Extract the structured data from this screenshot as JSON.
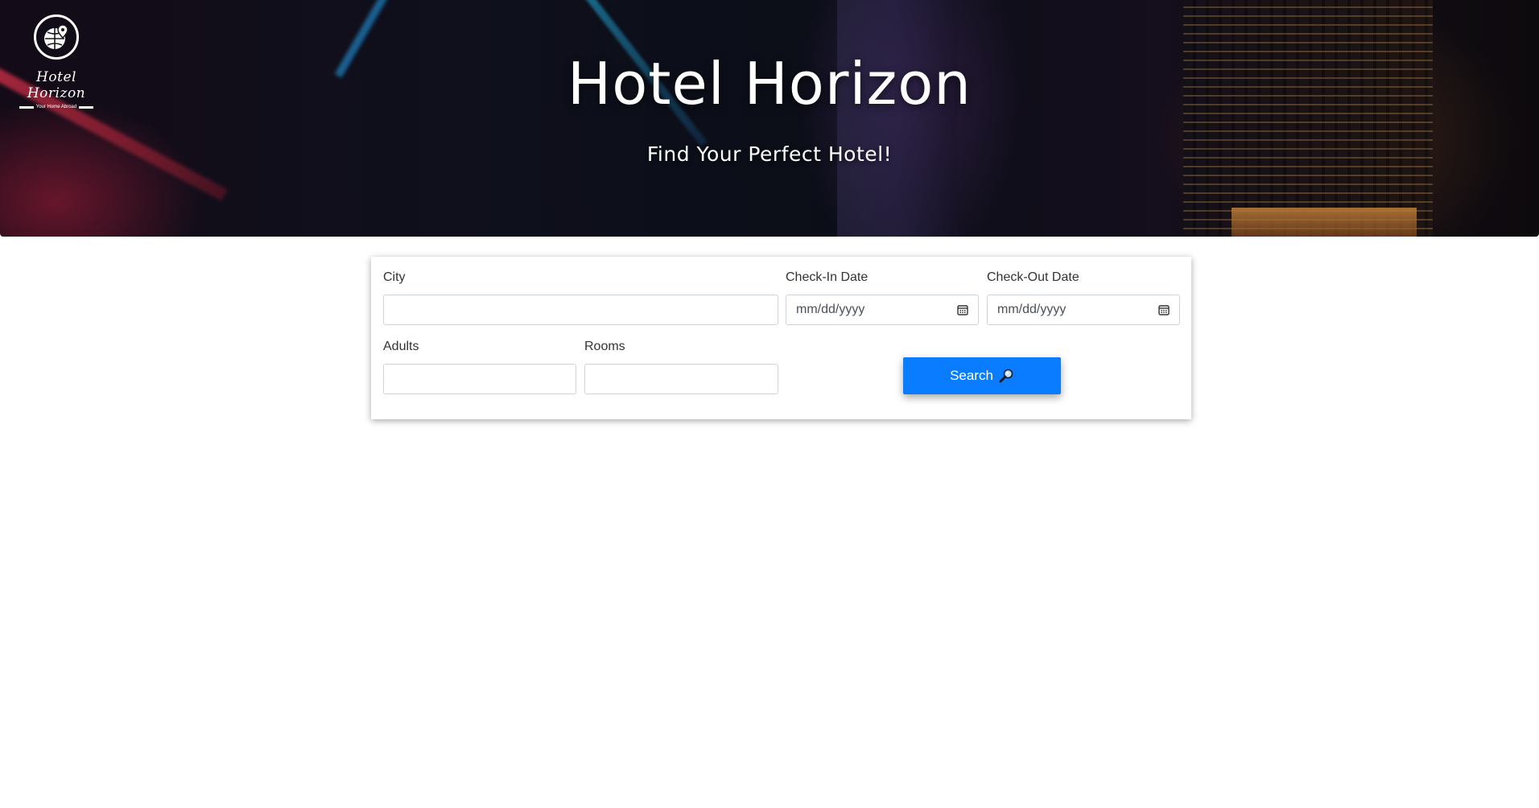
{
  "brand": {
    "logo_script": "Hotel Horizon",
    "logo_tagline": "Your Home Abroad",
    "logo_icon": "globe-pin-icon"
  },
  "hero": {
    "title": "Hotel Horizon",
    "subtitle": "Find Your Perfect Hotel!"
  },
  "search_form": {
    "city": {
      "label": "City",
      "value": ""
    },
    "check_in": {
      "label": "Check-In Date",
      "placeholder": "mm/dd/yyyy"
    },
    "check_out": {
      "label": "Check-Out Date",
      "placeholder": "mm/dd/yyyy"
    },
    "adults": {
      "label": "Adults",
      "value": ""
    },
    "rooms": {
      "label": "Rooms",
      "value": ""
    },
    "search_button": {
      "label": "Search",
      "icon": "magnifier-icon"
    }
  },
  "colors": {
    "primary_button": "#0a7cff",
    "input_border": "#ced4da"
  }
}
